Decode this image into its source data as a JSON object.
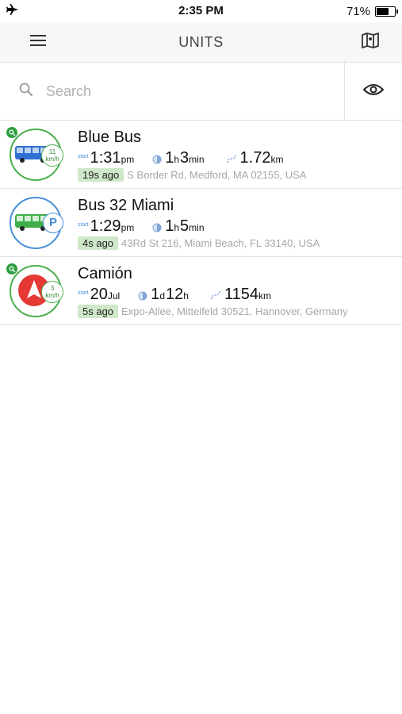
{
  "status_bar": {
    "time": "2:35 PM",
    "battery": "71%"
  },
  "navbar": {
    "title": "UNITS"
  },
  "search": {
    "placeholder": "Search"
  },
  "units": [
    {
      "name": "Blue Bus",
      "start_label": "start",
      "start_time": "1:31",
      "start_suffix": "pm",
      "dur_1": "1",
      "dur_1_unit": "h",
      "dur_2": "3",
      "dur_2_unit": "min",
      "distance": "1.72",
      "distance_unit": "km",
      "speed_value": "11",
      "speed_unit": "km/h",
      "ago": "19s ago",
      "address": "S Border Rd, Medford, MA 02155, USA"
    },
    {
      "name": "Bus 32 Miami",
      "start_label": "start",
      "start_time": "1:29",
      "start_suffix": "pm",
      "dur_1": "1",
      "dur_1_unit": "h",
      "dur_2": "5",
      "dur_2_unit": "min",
      "parking_label": "P",
      "ago": "4s ago",
      "address": "43Rd St 216, Miami Beach, FL 33140, USA"
    },
    {
      "name": "Camión",
      "start_label": "start",
      "start_time": "20",
      "start_suffix": "Jul",
      "dur_1": "1",
      "dur_1_unit": "d",
      "dur_2": "12",
      "dur_2_unit": "h",
      "distance": "1154",
      "distance_unit": "km",
      "speed_value": "3",
      "speed_unit": "km/h",
      "ago": "5s ago",
      "address": "Expo-Allee, Mittelfeld 30521, Hannover, Germany"
    }
  ],
  "colors": {
    "moving": "#4caf50",
    "parked": "#4a90d9",
    "ago_bg": "#cfe8c9",
    "arrow_red": "#e53935"
  }
}
